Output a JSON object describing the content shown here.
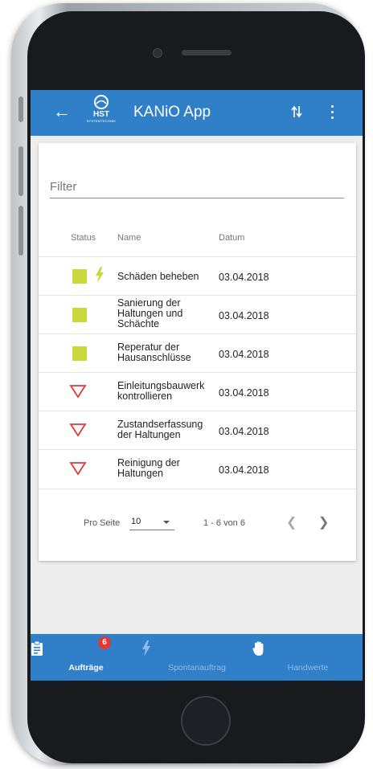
{
  "app": {
    "title": "KANiO App",
    "logo_text": "HST",
    "logo_subtext": "SYSTEMTECHNIK"
  },
  "appbar": {
    "back_icon": "arrow-left-icon",
    "sort_icon": "sort-icon",
    "more_icon": "more-vert-icon"
  },
  "filter": {
    "placeholder": "Filter",
    "value": ""
  },
  "table": {
    "columns": [
      "Status",
      "Name",
      "Datum"
    ],
    "rows": [
      {
        "status": "square-yellow",
        "bolt": true,
        "name": "Schäden beheben",
        "date": "03.04.2018"
      },
      {
        "status": "square-yellow",
        "bolt": false,
        "name": "Sanierung der Haltungen und Schächte",
        "date": "03.04.2018"
      },
      {
        "status": "square-yellow",
        "bolt": false,
        "name": "Reperatur der Hausanschlüsse",
        "date": "03.04.2018"
      },
      {
        "status": "triangle-red",
        "bolt": false,
        "name": "Einleitungsbauwerk kontrollieren",
        "date": "03.04.2018"
      },
      {
        "status": "triangle-red",
        "bolt": false,
        "name": "Zustandserfassung der Haltungen",
        "date": "03.04.2018"
      },
      {
        "status": "triangle-red",
        "bolt": false,
        "name": "Reinigung der Haltungen",
        "date": "03.04.2018"
      }
    ]
  },
  "pagination": {
    "per_page_label": "Pro Seite",
    "per_page_value": "10",
    "range": "1 - 6 von 6",
    "prev_icon": "chevron-left-icon",
    "next_icon": "chevron-right-icon"
  },
  "bottom_nav": {
    "tabs": [
      {
        "label": "Aufträge",
        "icon": "clipboard-icon",
        "badge": "6",
        "active": true
      },
      {
        "label": "Spontanauftrag",
        "icon": "bolt-icon",
        "active": false
      },
      {
        "label": "Handwerte",
        "icon": "hand-icon",
        "active": false
      }
    ]
  },
  "colors": {
    "primary": "#2f7fc9",
    "status_yellow": "#c9d93a",
    "status_red": "#e53935",
    "badge": "#e53935"
  }
}
